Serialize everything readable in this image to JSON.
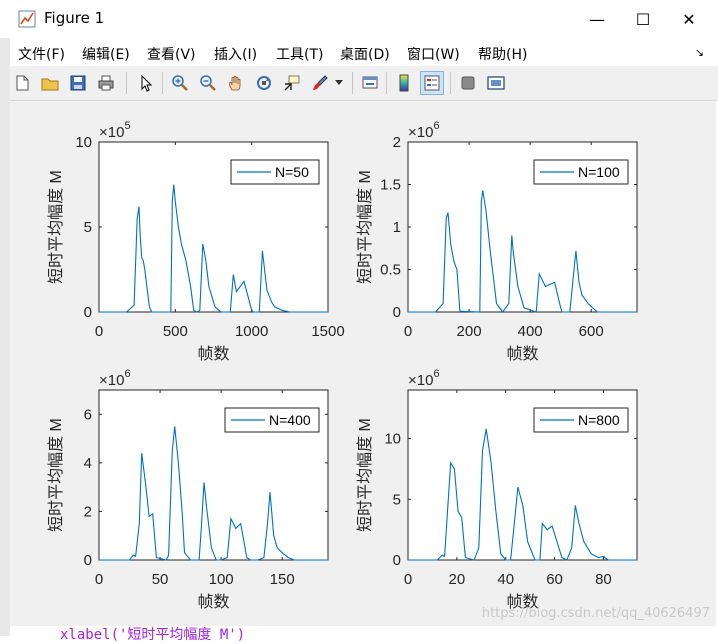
{
  "window": {
    "title": "Figure 1",
    "minimize_glyph": "—",
    "maximize_glyph": "☐",
    "close_glyph": "✕"
  },
  "menu": {
    "items": [
      "文件(F)",
      "编辑(E)",
      "查看(V)",
      "插入(I)",
      "工具(T)",
      "桌面(D)",
      "窗口(W)",
      "帮助(H)"
    ]
  },
  "toolbar": {
    "icons": [
      "new-figure-icon",
      "open-icon",
      "save-icon",
      "print-icon",
      "pointer-icon",
      "zoom-in-icon",
      "zoom-out-icon",
      "pan-icon",
      "rotate-3d-icon",
      "data-cursor-icon",
      "brush-icon",
      "brush-dropdown-icon",
      "link-plot-icon",
      "colorbar-icon",
      "legend-icon",
      "hide-plot-tools-icon",
      "show-plot-tools-icon"
    ]
  },
  "colors": {
    "line": "#0072bd",
    "figure_bg": "#f0f0f0",
    "axes_bg": "#ffffff"
  },
  "chart_data": [
    {
      "type": "line",
      "xlabel": "帧数",
      "ylabel": "短时平均幅度 M",
      "exponent_base": "×10",
      "exponent": "5",
      "xlim": [
        0,
        1500
      ],
      "ylim": [
        0,
        10
      ],
      "xticks": [
        0,
        500,
        1000,
        1500
      ],
      "yticks": [
        0,
        5,
        10
      ],
      "legend": "N=50",
      "series": [
        {
          "name": "N=50",
          "x": [
            0,
            180,
            230,
            250,
            262,
            270,
            280,
            290,
            300,
            320,
            330,
            345,
            470,
            480,
            490,
            500,
            520,
            540,
            570,
            600,
            620,
            640,
            660,
            680,
            700,
            720,
            760,
            800,
            860,
            880,
            900,
            950,
            1000,
            1010,
            1050,
            1070,
            1100,
            1130,
            1150,
            1200,
            1250,
            1500
          ],
          "y": [
            0,
            0,
            0.4,
            5.5,
            6.2,
            4.5,
            3.2,
            3.0,
            2.5,
            1.0,
            0.3,
            0,
            0,
            6.5,
            7.5,
            6.5,
            5.0,
            4.0,
            3.0,
            1.5,
            0.1,
            0,
            0.1,
            4.0,
            3.0,
            1.5,
            0.3,
            0,
            0,
            2.2,
            1.2,
            1.8,
            0.1,
            0,
            0,
            3.6,
            1.3,
            0.6,
            0.3,
            0.1,
            0,
            0
          ]
        }
      ]
    },
    {
      "type": "line",
      "xlabel": "帧数",
      "ylabel": "短时平均幅度 M",
      "exponent_base": "×10",
      "exponent": "6",
      "xlim": [
        0,
        750
      ],
      "ylim": [
        0,
        2
      ],
      "xticks": [
        0,
        200,
        400,
        600
      ],
      "yticks": [
        0,
        0.5,
        1,
        1.5,
        2
      ],
      "legend": "N=100",
      "series": [
        {
          "name": "N=100",
          "x": [
            0,
            90,
            115,
            125,
            131,
            140,
            150,
            160,
            170,
            235,
            240,
            245,
            255,
            270,
            290,
            310,
            330,
            340,
            345,
            360,
            380,
            420,
            430,
            450,
            480,
            500,
            505,
            530,
            550,
            560,
            570,
            590,
            620,
            750
          ],
          "y": [
            0,
            0,
            0.1,
            1.1,
            1.17,
            0.8,
            0.6,
            0.5,
            0.01,
            0,
            1.3,
            1.43,
            1.2,
            0.7,
            0.1,
            0,
            0.1,
            0.9,
            0.7,
            0.3,
            0.05,
            0,
            0.45,
            0.3,
            0.35,
            0.05,
            0,
            0,
            0.72,
            0.35,
            0.2,
            0.1,
            0,
            0
          ]
        }
      ]
    },
    {
      "type": "line",
      "xlabel": "帧数",
      "ylabel": "短时平均幅度 M",
      "exponent_base": "×10",
      "exponent": "6",
      "xlim": [
        0,
        187.5
      ],
      "ylim": [
        0,
        7
      ],
      "xticks": [
        0,
        50,
        100,
        150
      ],
      "yticks": [
        0,
        2,
        4,
        6
      ],
      "legend": "N=400",
      "series": [
        {
          "name": "N=400",
          "x": [
            0,
            25,
            28,
            30,
            33,
            35,
            38,
            41,
            44,
            47,
            55,
            57,
            60,
            62,
            65,
            68,
            70,
            75,
            82,
            84,
            86,
            88,
            92,
            96,
            100,
            105,
            108,
            112,
            116,
            121,
            124,
            130,
            135,
            138,
            140,
            143,
            146,
            150,
            155,
            160,
            187.5
          ],
          "y": [
            0,
            0,
            0.2,
            0.15,
            1.5,
            4.4,
            3.2,
            1.8,
            1.9,
            0.1,
            0,
            0.2,
            4.5,
            5.5,
            4.0,
            2.0,
            0.3,
            0,
            0,
            1.5,
            3.2,
            2.2,
            0.5,
            0,
            0,
            0.1,
            1.7,
            1.3,
            1.5,
            0.1,
            0,
            0,
            0.1,
            1.5,
            2.8,
            1.0,
            0.5,
            0.3,
            0.1,
            0,
            0
          ]
        }
      ]
    },
    {
      "type": "line",
      "xlabel": "帧数",
      "ylabel": "短时平均幅度 M",
      "exponent_base": "×10",
      "exponent": "6",
      "xlim": [
        0,
        93.75
      ],
      "ylim": [
        0,
        14
      ],
      "xticks": [
        0,
        20,
        40,
        60,
        80
      ],
      "yticks": [
        0,
        5,
        10
      ],
      "legend": "N=800",
      "series": [
        {
          "name": "N=800",
          "x": [
            0,
            12,
            14,
            15,
            16,
            17.5,
            19,
            20.5,
            22,
            23.5,
            27,
            29,
            30.5,
            32,
            34,
            36,
            38,
            40,
            42,
            43.5,
            45,
            47,
            49,
            52,
            54,
            55,
            57,
            59,
            61,
            63,
            65,
            67,
            68.5,
            70,
            72,
            75,
            78,
            80,
            82,
            93.75
          ],
          "y": [
            0,
            0,
            0.4,
            0.3,
            3.5,
            8.0,
            7.5,
            4.0,
            3.5,
            0.2,
            0,
            1.0,
            9.0,
            10.8,
            8.0,
            4.0,
            0.5,
            0,
            0,
            3.0,
            6.0,
            4.5,
            1.5,
            0,
            0,
            3.0,
            2.5,
            2.8,
            1.5,
            0.2,
            0,
            1.0,
            4.5,
            3.0,
            1.5,
            0.5,
            0.2,
            0.3,
            0,
            0
          ]
        }
      ]
    }
  ],
  "background_code": "xlabel('短时平均幅度 M')",
  "watermark": "https://blog.csdn.net/qq_40626497"
}
